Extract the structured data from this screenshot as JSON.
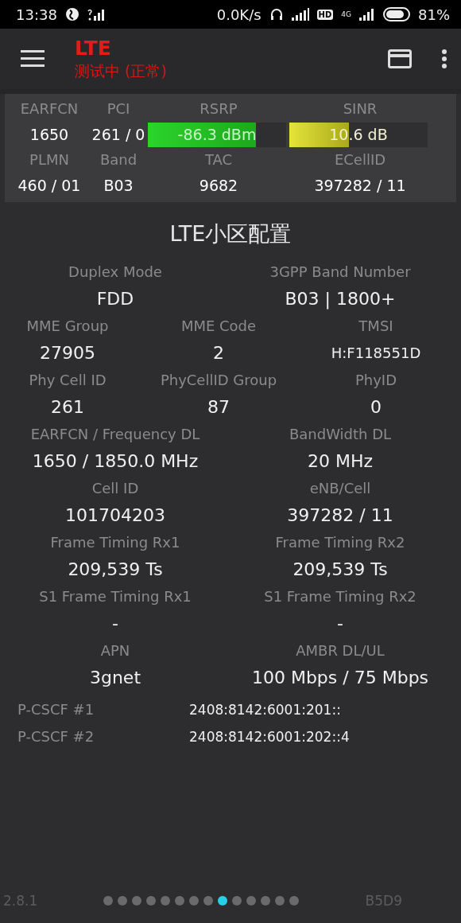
{
  "status_bar": {
    "time": "13:38",
    "speed": "0.0K/s",
    "hd": "HD",
    "network": "4G",
    "battery": "81%"
  },
  "toolbar": {
    "title": "LTE",
    "subtitle": "测试中 (正常)"
  },
  "signal_panel": {
    "earfcn_label": "EARFCN",
    "pci_label": "PCI",
    "rsrp_label": "RSRP",
    "sinr_label": "SINR",
    "earfcn": "1650",
    "pci": "261 / 0",
    "rsrp": {
      "reading": "-86.3 dBm",
      "level": 0.78
    },
    "sinr": {
      "reading": "10.6 dB",
      "level": 0.43
    },
    "plmn_label": "PLMN",
    "band_label": "Band",
    "tac_label": "TAC",
    "ecellid_label": "ECellID",
    "plmn": "460 / 01",
    "band": "B03",
    "tac": "9682",
    "ecellid": "397282 / 11"
  },
  "section_title": "LTE小区配置",
  "rows": [
    [
      {
        "label": "Duplex Mode",
        "value": "FDD"
      },
      {
        "label": "3GPP Band Number",
        "value": "B03 | 1800+"
      }
    ],
    [
      {
        "label": "MME Group",
        "value": "27905"
      },
      {
        "label": "MME Code",
        "value": "2"
      },
      {
        "label": "TMSI",
        "value": "H:F118551D"
      }
    ],
    [
      {
        "label": "Phy Cell ID",
        "value": "261"
      },
      {
        "label": "PhyCellID Group",
        "value": "87"
      },
      {
        "label": "PhyID",
        "value": "0"
      }
    ],
    [
      {
        "label": "EARFCN / Frequency DL",
        "value": "1650 / 1850.0 MHz"
      },
      {
        "label": "BandWidth DL",
        "value": "20 MHz"
      }
    ],
    [
      {
        "label": "Cell ID",
        "value": "101704203"
      },
      {
        "label": "eNB/Cell",
        "value": "397282 / 11"
      }
    ],
    [
      {
        "label": "Frame Timing Rx1",
        "value": "209,539 Ts"
      },
      {
        "label": "Frame Timing Rx2",
        "value": "209,539 Ts"
      }
    ],
    [
      {
        "label": "S1 Frame Timing Rx1",
        "value": "-"
      },
      {
        "label": "S1 Frame Timing Rx2",
        "value": "-"
      }
    ],
    [
      {
        "label": "APN",
        "value": "3gnet"
      },
      {
        "label": "AMBR DL/UL",
        "value": "100 Mbps / 75 Mbps"
      }
    ]
  ],
  "pcscf": [
    {
      "label": "P-CSCF #1",
      "value": "2408:8142:6001:201::"
    },
    {
      "label": "P-CSCF #2",
      "value": "2408:8142:6001:202::4"
    }
  ],
  "footer": {
    "version": "2.8.1",
    "code": "B5D9",
    "pages": [
      {
        "selected": false
      },
      {
        "selected": false
      },
      {
        "selected": false
      },
      {
        "selected": false
      },
      {
        "selected": false
      },
      {
        "selected": false
      },
      {
        "selected": false
      },
      {
        "selected": false
      },
      {
        "selected": true
      },
      {
        "selected": false
      },
      {
        "selected": false
      },
      {
        "selected": false
      },
      {
        "selected": false
      },
      {
        "selected": false
      }
    ]
  }
}
